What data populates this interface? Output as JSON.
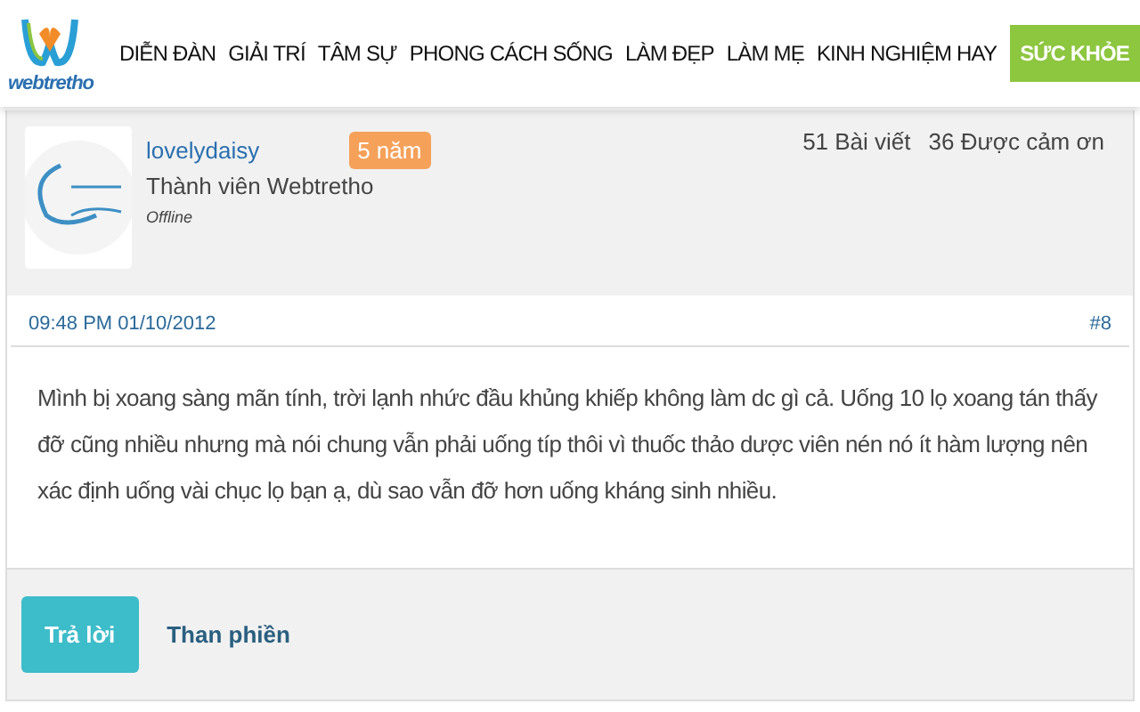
{
  "logo": {
    "text": "webtretho"
  },
  "nav": [
    {
      "label": "DIỄN ĐÀN",
      "selected": false
    },
    {
      "label": "GIẢI TRÍ",
      "selected": false
    },
    {
      "label": "TÂM SỰ",
      "selected": false
    },
    {
      "label": "PHONG CÁCH SỐNG",
      "selected": false
    },
    {
      "label": "LÀM ĐẸP",
      "selected": false
    },
    {
      "label": "LÀM MẸ",
      "selected": false
    },
    {
      "label": "KINH NGHIỆM HAY",
      "selected": false
    },
    {
      "label": "SỨC KHỎE",
      "selected": true
    }
  ],
  "post": {
    "username": "lovelydaisy",
    "badge": "5 năm",
    "rank": "Thành viên Webtretho",
    "status": "Offline",
    "posts": "51 Bài viết",
    "thanks": "36 Được cảm ơn",
    "time": "09:48 PM 01/10/2012",
    "number": "#8",
    "body": "Mình bị xoang sàng mãn tính, trời lạnh nhức đầu khủng khiếp không làm dc gì cả. Uống 10 lọ xoang tán thấy đỡ cũng nhiều nhưng mà nói chung vẫn phải uống típ thôi vì thuốc thảo dược viên nén nó ít hàm lượng nên xác định uống vài chục lọ bạn ạ, dù sao vẫn đỡ hơn uống kháng sinh nhiều.",
    "reply": "Trả lời",
    "report": "Than phiền"
  }
}
